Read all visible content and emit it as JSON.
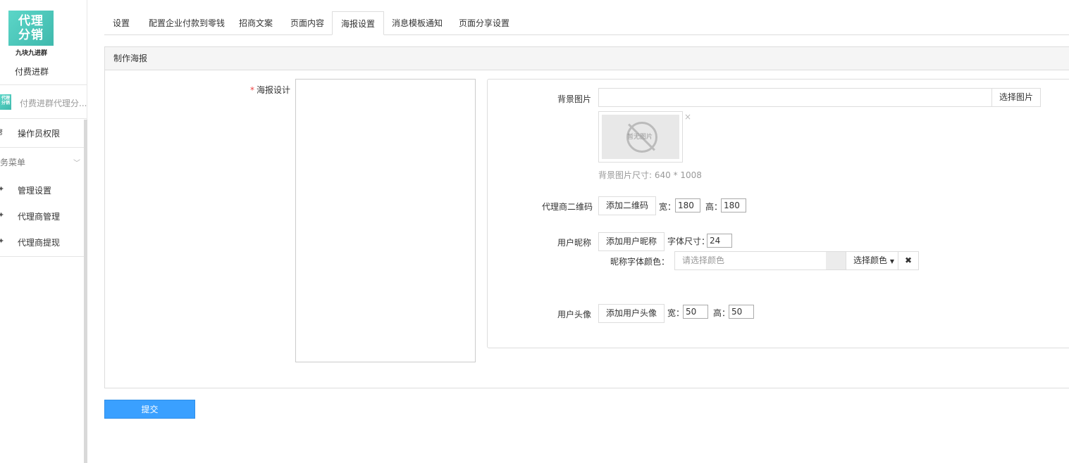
{
  "sidebar": {
    "logo_text_line1": "代理",
    "logo_text_line2": "分销",
    "logo_caption": "九块九进群",
    "app_name": "付费进群",
    "sub_app": "付费进群代理分...",
    "operator": "操作员权限",
    "group_title": "务菜单",
    "items": [
      {
        "label": "管理设置",
        "icon": "gear-icon"
      },
      {
        "label": "代理商管理",
        "icon": "gear-icon"
      },
      {
        "label": "代理商提现",
        "icon": "gear-icon"
      }
    ]
  },
  "tabs": [
    {
      "label": "设置"
    },
    {
      "label": "配置企业付款到零钱"
    },
    {
      "label": "招商文案"
    },
    {
      "label": "页面内容"
    },
    {
      "label": "海报设置",
      "active": true
    },
    {
      "label": "消息模板通知"
    },
    {
      "label": "页面分享设置"
    }
  ],
  "panel": {
    "title": "制作海报",
    "poster_label": "海报设计",
    "required_mark": "*"
  },
  "settings": {
    "bg_label": "背景图片",
    "bg_value": "",
    "bg_button": "选择图片",
    "no_image_text": "暂无图片",
    "remove_icon": "×",
    "bg_hint": "背景图片尺寸: 640 * 1008",
    "qr_label": "代理商二维码",
    "qr_button": "添加二维码",
    "width_label": "宽：",
    "height_label": "高：",
    "qr_width": "180",
    "qr_height": "180",
    "nick_label": "用户昵称",
    "nick_button": "添加用户昵称",
    "font_size_label": "字体尺寸：",
    "nick_font_size": "24",
    "nick_color_label": "昵称字体颜色：",
    "nick_color_placeholder": "请选择颜色",
    "color_button": "选择颜色",
    "clear_icon": "✖",
    "avatar_label": "用户头像",
    "avatar_button": "添加用户头像",
    "avatar_width": "50",
    "avatar_height": "50"
  },
  "submit_label": "提交",
  "colors": {
    "primary": "#3aa0ff",
    "logo": "#4cc9bc"
  }
}
